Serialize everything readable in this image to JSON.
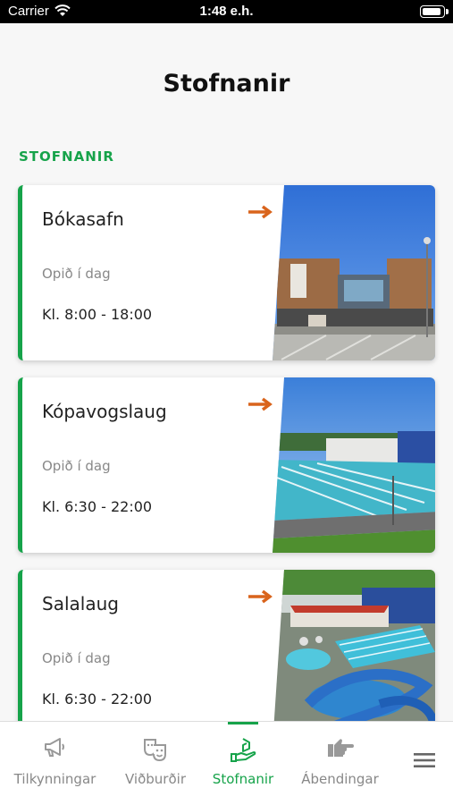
{
  "status_bar": {
    "carrier": "Carrier",
    "time": "1:48 e.h.",
    "battery_level": 0.95
  },
  "header": {
    "title": "Stofnanir"
  },
  "section": {
    "label": "STOFNANIR"
  },
  "colors": {
    "accent": "#16a34a",
    "arrow": "#d9641c",
    "text": "#222222",
    "muted": "#888888"
  },
  "cards": [
    {
      "name": "Bókasafn",
      "status": "Opið í dag",
      "hours": "Kl. 8:00 - 18:00",
      "arrow_icon": "arrow-right-icon",
      "image": "library-building-photo"
    },
    {
      "name": "Kópavogslaug",
      "status": "Opið í dag",
      "hours": "Kl. 6:30 - 22:00",
      "arrow_icon": "arrow-right-icon",
      "image": "outdoor-pool-photo"
    },
    {
      "name": "Salalaug",
      "status": "Opið í dag",
      "hours": "Kl. 6:30 - 22:00",
      "arrow_icon": "arrow-right-icon",
      "image": "waterpark-aerial-photo"
    }
  ],
  "tabs": [
    {
      "label": "Tilkynningar",
      "icon": "megaphone-icon",
      "active": false
    },
    {
      "label": "Viðburðir",
      "icon": "theater-masks-icon",
      "active": false
    },
    {
      "label": "Stofnanir",
      "icon": "hand-building-icon",
      "active": true
    },
    {
      "label": "Ábendingar",
      "icon": "pointing-hand-icon",
      "active": false
    },
    {
      "label": "",
      "icon": "menu-icon",
      "active": false
    }
  ]
}
